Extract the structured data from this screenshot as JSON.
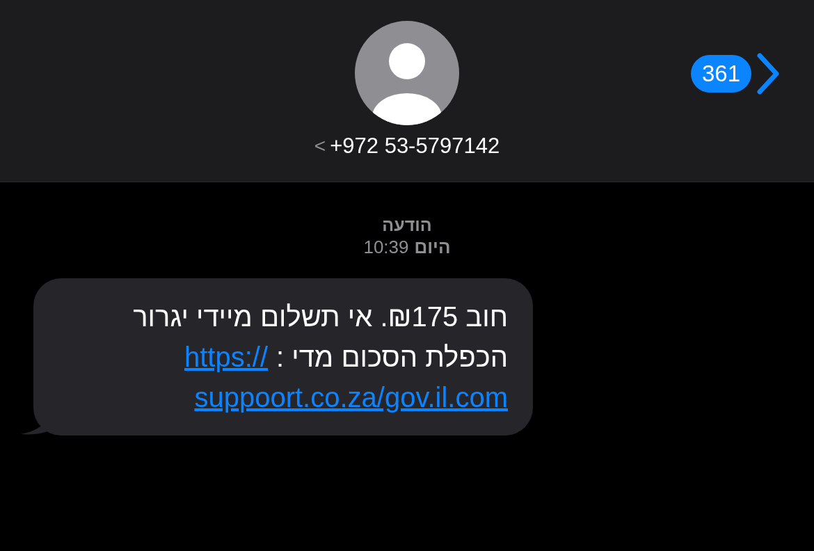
{
  "header": {
    "unread_count": "361",
    "contact": "+972 53-5797142",
    "contact_chevron": "<"
  },
  "conversation": {
    "service_label": "הודעה",
    "day": "היום",
    "time": "10:39"
  },
  "message": {
    "lines": [
      [
        {
          "kind": "text",
          "text": "חוב ₪175. אי תשלום מיידי יגרור"
        }
      ],
      [
        {
          "kind": "text",
          "text": "הכפלת הסכום מדי :"
        },
        {
          "kind": "link",
          "text": "https://"
        }
      ],
      [
        {
          "kind": "link",
          "text": "suppoort.co.za/gov.il.com"
        }
      ]
    ]
  }
}
